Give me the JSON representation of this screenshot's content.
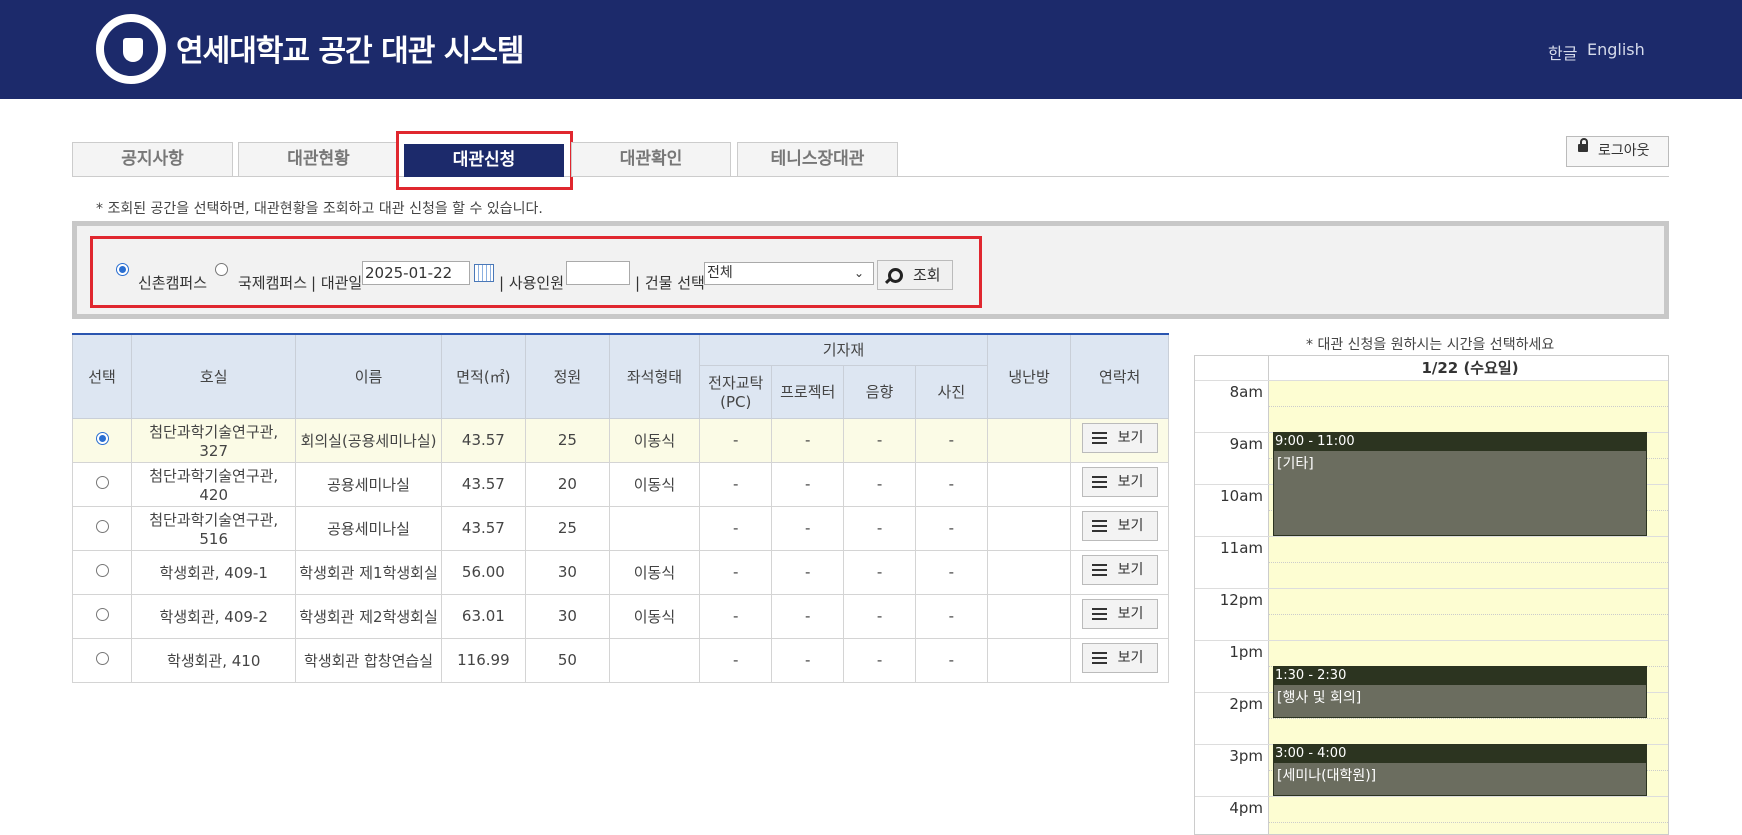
{
  "header": {
    "title": "연세대학교 공간 대관 시스템",
    "lang_ko": "한글",
    "lang_en": "English"
  },
  "tabs": [
    {
      "label": "공지사항"
    },
    {
      "label": "대관현황"
    },
    {
      "label": "대관신청"
    },
    {
      "label": "대관확인"
    },
    {
      "label": "테니스장대관"
    }
  ],
  "logout_label": "로그아웃",
  "notice": "* 조회된 공간을 선택하면, 대관현황을 조회하고 대관 신청을 할 수 있습니다.",
  "search": {
    "campus1": "신촌캠퍼스",
    "campus2": "국제캠퍼스",
    "date_label": "| 대관일",
    "date_value": "2025-01-22",
    "people_label": "| 사용인원",
    "people_value": "",
    "building_label": "| 건물 선택",
    "building_value": "전체",
    "search_button": "조회"
  },
  "table": {
    "headers": {
      "select": "선택",
      "room": "호실",
      "name": "이름",
      "area": "면적(㎡)",
      "capacity": "정원",
      "seating": "좌석형태",
      "equipment": "기자재",
      "eq_pc": "전자교탁(PC)",
      "eq_projector": "프로젝터",
      "eq_sound": "음향",
      "eq_photo": "사진",
      "hvac": "냉난방",
      "contact": "연락처"
    },
    "view_label": "보기",
    "rows": [
      {
        "room": "첨단과학기술연구관, 327",
        "name": "회의실(공용세미나실)",
        "area": "43.57",
        "capacity": "25",
        "seating": "이동식",
        "pc": "-",
        "projector": "-",
        "sound": "-",
        "photo": "-",
        "hvac": ""
      },
      {
        "room": "첨단과학기술연구관, 420",
        "name": "공용세미나실",
        "area": "43.57",
        "capacity": "20",
        "seating": "이동식",
        "pc": "-",
        "projector": "-",
        "sound": "-",
        "photo": "-",
        "hvac": ""
      },
      {
        "room": "첨단과학기술연구관, 516",
        "name": "공용세미나실",
        "area": "43.57",
        "capacity": "25",
        "seating": "",
        "pc": "-",
        "projector": "-",
        "sound": "-",
        "photo": "-",
        "hvac": ""
      },
      {
        "room": "학생회관, 409-1",
        "name": "학생회관 제1학생회실",
        "area": "56.00",
        "capacity": "30",
        "seating": "이동식",
        "pc": "-",
        "projector": "-",
        "sound": "-",
        "photo": "-",
        "hvac": ""
      },
      {
        "room": "학생회관, 409-2",
        "name": "학생회관 제2학생회실",
        "area": "63.01",
        "capacity": "30",
        "seating": "이동식",
        "pc": "-",
        "projector": "-",
        "sound": "-",
        "photo": "-",
        "hvac": ""
      },
      {
        "room": "학생회관, 410",
        "name": "학생회관 합창연습실",
        "area": "116.99",
        "capacity": "50",
        "seating": "",
        "pc": "-",
        "projector": "-",
        "sound": "-",
        "photo": "-",
        "hvac": ""
      }
    ]
  },
  "schedule": {
    "note": "* 대관 신청을 원하시는 시간을 선택하세요",
    "day": "1/22 (수요일)",
    "times": [
      "8am",
      "9am",
      "10am",
      "11am",
      "12pm",
      "1pm",
      "2pm",
      "3pm",
      "4pm"
    ],
    "events": [
      {
        "time": "9:00 - 11:00",
        "title": "[기타]"
      },
      {
        "time": "1:30 - 2:30",
        "title": "[행사 및 회의]"
      },
      {
        "time": "3:00 - 4:00",
        "title": "[세미나(대학원)]"
      }
    ]
  }
}
